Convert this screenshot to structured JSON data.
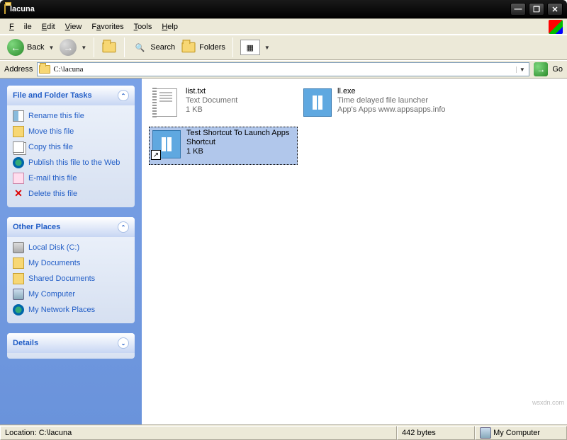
{
  "window": {
    "title": "lacuna"
  },
  "menu": {
    "file": "File",
    "edit": "Edit",
    "view": "View",
    "favorites": "Favorites",
    "tools": "Tools",
    "help": "Help"
  },
  "toolbar": {
    "back": "Back",
    "search": "Search",
    "folders": "Folders"
  },
  "address": {
    "label": "Address",
    "value": "C:\\lacuna",
    "go": "Go"
  },
  "sidebar": {
    "tasks": {
      "title": "File and Folder Tasks",
      "items": [
        {
          "icon": "rename-icon",
          "label": "Rename this file"
        },
        {
          "icon": "move-icon",
          "label": "Move this file"
        },
        {
          "icon": "copy-icon",
          "label": "Copy this file"
        },
        {
          "icon": "publish-icon",
          "label": "Publish this file to the Web"
        },
        {
          "icon": "email-icon",
          "label": "E-mail this file"
        },
        {
          "icon": "delete-icon",
          "label": "Delete this file"
        }
      ]
    },
    "places": {
      "title": "Other Places",
      "items": [
        {
          "icon": "disk-icon",
          "label": "Local Disk (C:)"
        },
        {
          "icon": "documents-icon",
          "label": "My Documents"
        },
        {
          "icon": "shared-documents-icon",
          "label": "Shared Documents"
        },
        {
          "icon": "computer-icon",
          "label": "My Computer"
        },
        {
          "icon": "network-places-icon",
          "label": "My Network Places"
        }
      ]
    },
    "details": {
      "title": "Details"
    }
  },
  "files": [
    {
      "name": "list.txt",
      "type": "Text Document",
      "size": "1 KB",
      "icon": "text-file-icon",
      "selected": false,
      "shortcut": false
    },
    {
      "name": "ll.exe",
      "type": "Time delayed file launcher",
      "size": "App's Apps  www.appsapps.info",
      "icon": "app-icon",
      "selected": false,
      "shortcut": false
    },
    {
      "name": "Test Shortcut To Launch Apps",
      "type": "Shortcut",
      "size": "1 KB",
      "icon": "app-icon",
      "selected": true,
      "shortcut": true
    }
  ],
  "status": {
    "location_label": "Location:",
    "location": "C:\\lacuna",
    "size": "442 bytes",
    "zone": "My Computer"
  },
  "watermark": "wsxdn.com"
}
